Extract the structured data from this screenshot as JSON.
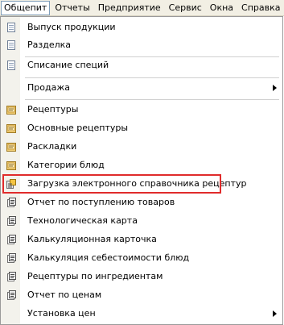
{
  "menubar": {
    "items": [
      "Общепит",
      "Отчеты",
      "Предприятие",
      "Сервис",
      "Окна",
      "Справка"
    ]
  },
  "menu": {
    "items": [
      {
        "label": "Выпуск продукции",
        "icon": "document-icon"
      },
      {
        "label": "Разделка",
        "icon": "document-icon"
      },
      {
        "label": "Списание специй",
        "icon": "document-icon"
      },
      {
        "label": "Продажа",
        "icon": "",
        "submenu": true
      },
      {
        "label": "Рецептуры",
        "icon": "catalog-icon"
      },
      {
        "label": "Основные рецептуры",
        "icon": "catalog-icon"
      },
      {
        "label": "Раскладки",
        "icon": "catalog-icon"
      },
      {
        "label": "Категории блюд",
        "icon": "catalog-icon"
      },
      {
        "label": "Загрузка электронного справочника рецептур",
        "icon": "data-processor-icon"
      },
      {
        "label": "Отчет по поступлению товаров",
        "icon": "report-icon"
      },
      {
        "label": "Технологическая карта",
        "icon": "report-icon"
      },
      {
        "label": "Калькуляционная карточка",
        "icon": "report-icon"
      },
      {
        "label": "Калькуляция себестоимости блюд",
        "icon": "report-icon"
      },
      {
        "label": "Рецептуры по ингредиентам",
        "icon": "report-icon"
      },
      {
        "label": "Отчет по ценам",
        "icon": "report-icon"
      },
      {
        "label": "Установка цен",
        "icon": "",
        "submenu": true
      }
    ]
  },
  "colors": {
    "highlight_border": "#e02b2b",
    "menubar_bg": "#f2efe4"
  }
}
